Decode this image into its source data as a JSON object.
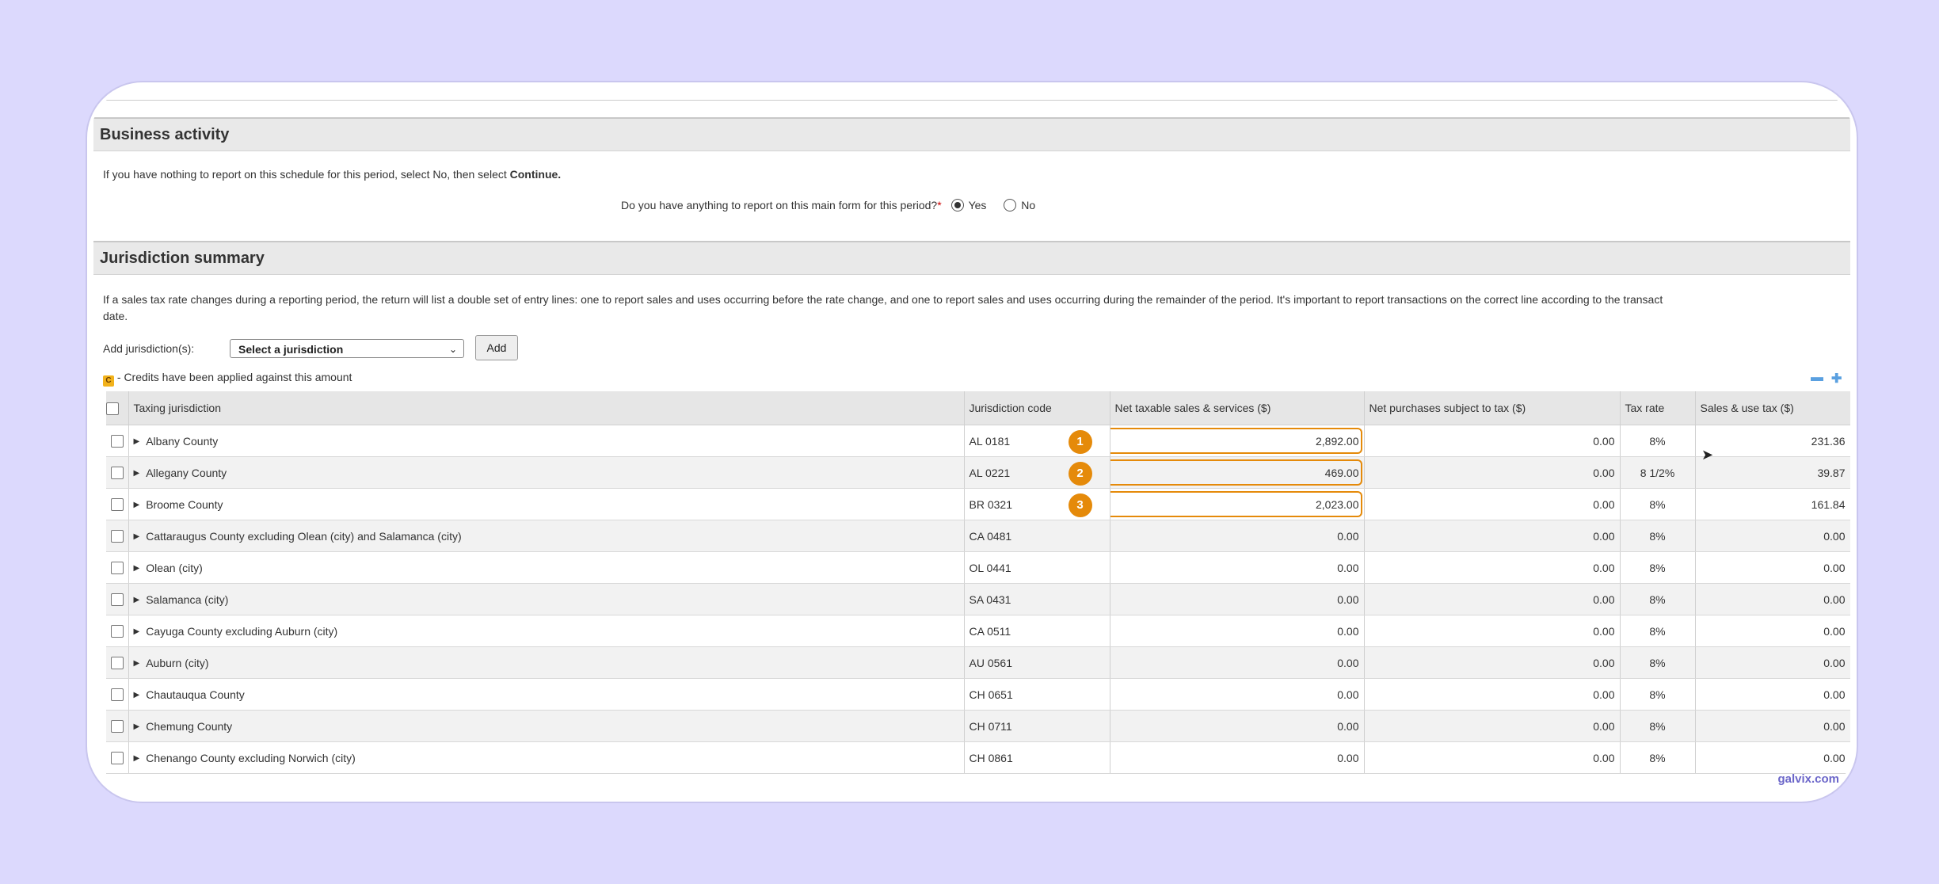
{
  "business_activity": {
    "title": "Business activity",
    "instruction_prefix": "If you have nothing to report on this schedule for this period, select No, then select",
    "instruction_bold": "Continue.",
    "question": "Do you have anything to report on this main form for this period?",
    "required_mark": "*",
    "yes_label": "Yes",
    "no_label": "No",
    "selected": "Yes"
  },
  "jurisdiction_summary": {
    "title": "Jurisdiction summary",
    "note_line1": "If a sales tax rate changes during a reporting period, the return will list a double set of entry lines: one to report sales and uses occurring before the rate change, and one to report sales and uses occurring during the remainder of the period. It's important to report transactions on the correct line according to the transact",
    "note_line2": "date.",
    "add_label": "Add jurisdiction(s):",
    "select_value": "Select a jurisdiction",
    "add_button": "Add",
    "credit_icon": "C",
    "credit_note": "- Credits have been applied against this amount",
    "collapse_icon": "minus-icon",
    "expand_icon": "plus-icon"
  },
  "table": {
    "headers": [
      "Taxing jurisdiction",
      "Jurisdiction code",
      "Net taxable sales & services ($)",
      "Net purchases subject to tax ($)",
      "Tax rate",
      "Sales & use tax ($)"
    ],
    "rows": [
      {
        "name": "Albany County",
        "code": "AL 0181",
        "net_sales": "2,892.00",
        "net_purchases": "0.00",
        "rate": "8%",
        "tax": "231.36",
        "badge": "1"
      },
      {
        "name": "Allegany County",
        "code": "AL 0221",
        "net_sales": "469.00",
        "net_purchases": "0.00",
        "rate": "8 1/2%",
        "tax": "39.87",
        "badge": "2"
      },
      {
        "name": "Broome County",
        "code": "BR 0321",
        "net_sales": "2,023.00",
        "net_purchases": "0.00",
        "rate": "8%",
        "tax": "161.84",
        "badge": "3"
      },
      {
        "name": "Cattaraugus County excluding Olean (city) and Salamanca (city)",
        "code": "CA 0481",
        "net_sales": "0.00",
        "net_purchases": "0.00",
        "rate": "8%",
        "tax": "0.00"
      },
      {
        "name": "Olean (city)",
        "code": "OL 0441",
        "net_sales": "0.00",
        "net_purchases": "0.00",
        "rate": "8%",
        "tax": "0.00"
      },
      {
        "name": "Salamanca (city)",
        "code": "SA 0431",
        "net_sales": "0.00",
        "net_purchases": "0.00",
        "rate": "8%",
        "tax": "0.00"
      },
      {
        "name": "Cayuga County excluding Auburn (city)",
        "code": "CA 0511",
        "net_sales": "0.00",
        "net_purchases": "0.00",
        "rate": "8%",
        "tax": "0.00"
      },
      {
        "name": "Auburn (city)",
        "code": "AU 0561",
        "net_sales": "0.00",
        "net_purchases": "0.00",
        "rate": "8%",
        "tax": "0.00"
      },
      {
        "name": "Chautauqua County",
        "code": "CH 0651",
        "net_sales": "0.00",
        "net_purchases": "0.00",
        "rate": "8%",
        "tax": "0.00"
      },
      {
        "name": "Chemung County",
        "code": "CH 0711",
        "net_sales": "0.00",
        "net_purchases": "0.00",
        "rate": "8%",
        "tax": "0.00"
      },
      {
        "name": "Chenango County excluding Norwich (city)",
        "code": "CH 0861",
        "net_sales": "0.00",
        "net_purchases": "0.00",
        "rate": "8%",
        "tax": "0.00"
      }
    ]
  },
  "watermark": "galvix.com",
  "colors": {
    "accent": "#e58a0a",
    "background": "#dcd9fd"
  }
}
